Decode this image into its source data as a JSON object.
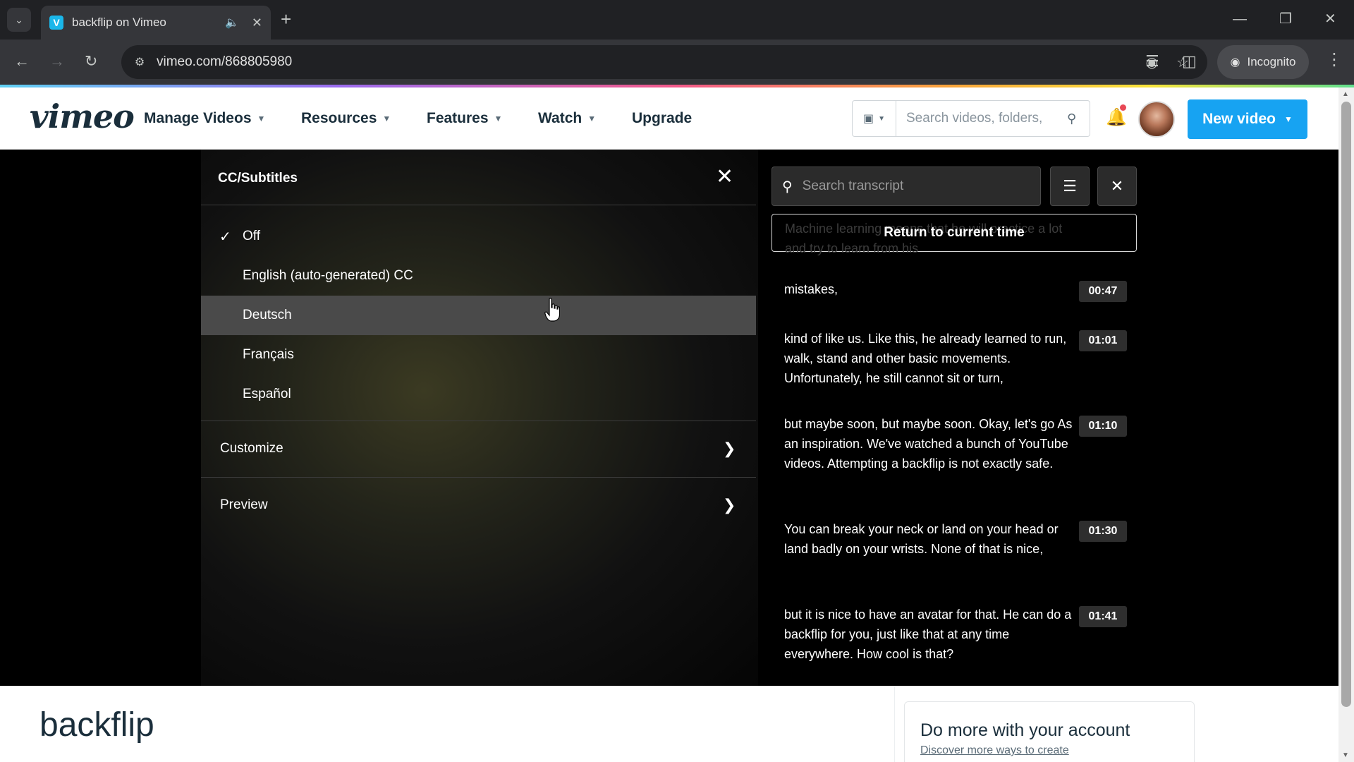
{
  "browser": {
    "tab_title": "backflip on Vimeo",
    "tab_favicon": "V",
    "url": "vimeo.com/868805980",
    "incognito_label": "Incognito"
  },
  "header": {
    "logo": "vimeo",
    "nav": [
      "Manage Videos",
      "Resources",
      "Features",
      "Watch",
      "Upgrade"
    ],
    "search_placeholder": "Search videos, folders,",
    "new_video_label": "New video"
  },
  "cc_panel": {
    "title": "CC/Subtitles",
    "options": [
      {
        "label": "Off",
        "selected": true
      },
      {
        "label": "English (auto-generated) CC",
        "selected": false
      },
      {
        "label": "Deutsch",
        "selected": false
      },
      {
        "label": "Français",
        "selected": false
      },
      {
        "label": "Español",
        "selected": false
      }
    ],
    "hovered_option": "Deutsch",
    "customize_label": "Customize",
    "preview_label": "Preview"
  },
  "transcript": {
    "search_placeholder": "Search transcript",
    "return_label": "Return to current time",
    "ghost_text": "Machine learning means that he will practice a lot and try to learn from his",
    "entries": [
      {
        "text": "mistakes,",
        "time": "00:47"
      },
      {
        "text": "kind of like us. Like this, he already learned to run, walk, stand and other basic movements. Unfortunately, he still cannot sit or turn,",
        "time": "01:01"
      },
      {
        "text": "but maybe soon, but maybe soon. Okay, let's go As an inspiration. We've watched a bunch of YouTube videos. Attempting a backflip is not exactly safe.",
        "time": "01:10"
      },
      {
        "text": "You can break your neck or land on your head or land badly on your wrists. None of that is nice,",
        "time": "01:30"
      },
      {
        "text": "but it is nice to have an avatar for that. He can do a backflip for you, just like that at any time everywhere. How cool is that?",
        "time": "01:41"
      }
    ]
  },
  "page": {
    "video_title": "backflip",
    "account_card_title": "Do more with your account",
    "account_card_link": "Discover more ways to create"
  },
  "colors": {
    "vimeo_blue": "#17a3f2",
    "vimeo_dark": "#1a2e3b",
    "hover_row": "#4a4a4a"
  }
}
